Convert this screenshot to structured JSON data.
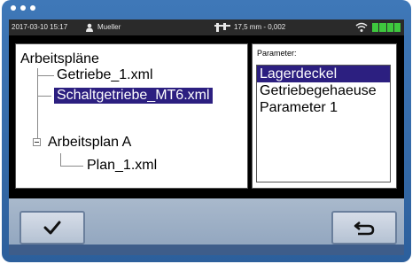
{
  "statusbar": {
    "datetime": "2017-03-10 15:17",
    "user": "Mueller",
    "measurement": "17,5 mm - 0,002"
  },
  "tree": {
    "root": "Arbeitspläne",
    "items": [
      {
        "label": "Getriebe_1.xml",
        "selected": false
      },
      {
        "label": "Schaltgetriebe_MT6.xml",
        "selected": true
      },
      {
        "label": "Arbeitsplan A",
        "selected": false
      },
      {
        "label": "Plan_1.xml",
        "selected": false
      }
    ]
  },
  "parameters": {
    "label": "Parameter:",
    "items": [
      {
        "label": "Lagerdeckel",
        "selected": true
      },
      {
        "label": "Getriebegehaeuse",
        "selected": false
      },
      {
        "label": "Parameter 1",
        "selected": false
      }
    ]
  },
  "icons": {
    "confirm": "checkmark-icon",
    "back": "return-arrow-icon",
    "user": "user-icon",
    "caliper": "caliper-icon",
    "wifi": "wifi-icon"
  },
  "colors": {
    "selection": "#2c1f80",
    "frame": "#3f78b8",
    "battery": "#3ec83e"
  }
}
